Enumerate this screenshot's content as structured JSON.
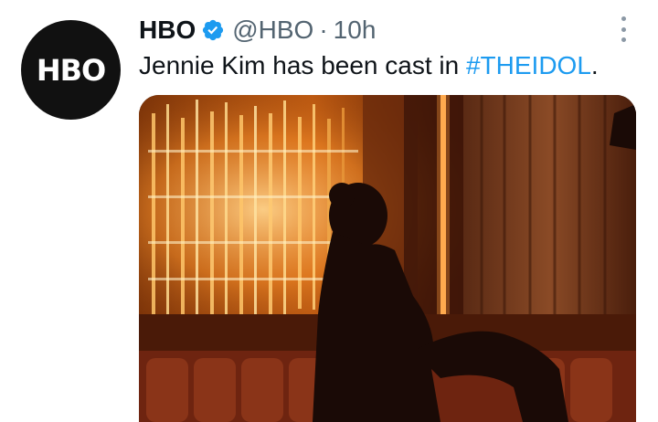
{
  "tweet": {
    "author_name": "HBO",
    "author_handle": "@HBO",
    "separator": "·",
    "timestamp": "10h",
    "avatar_text": "HBO",
    "text_prefix": "Jennie Kim has been cast in ",
    "hashtag": "#THEIDOL",
    "text_suffix": "."
  },
  "icons": {
    "verified": "verified-badge-icon",
    "more": "more-options-icon"
  },
  "colors": {
    "link": "#1d9bf0",
    "verified": "#1d9bf0",
    "secondary_text": "#536471"
  }
}
